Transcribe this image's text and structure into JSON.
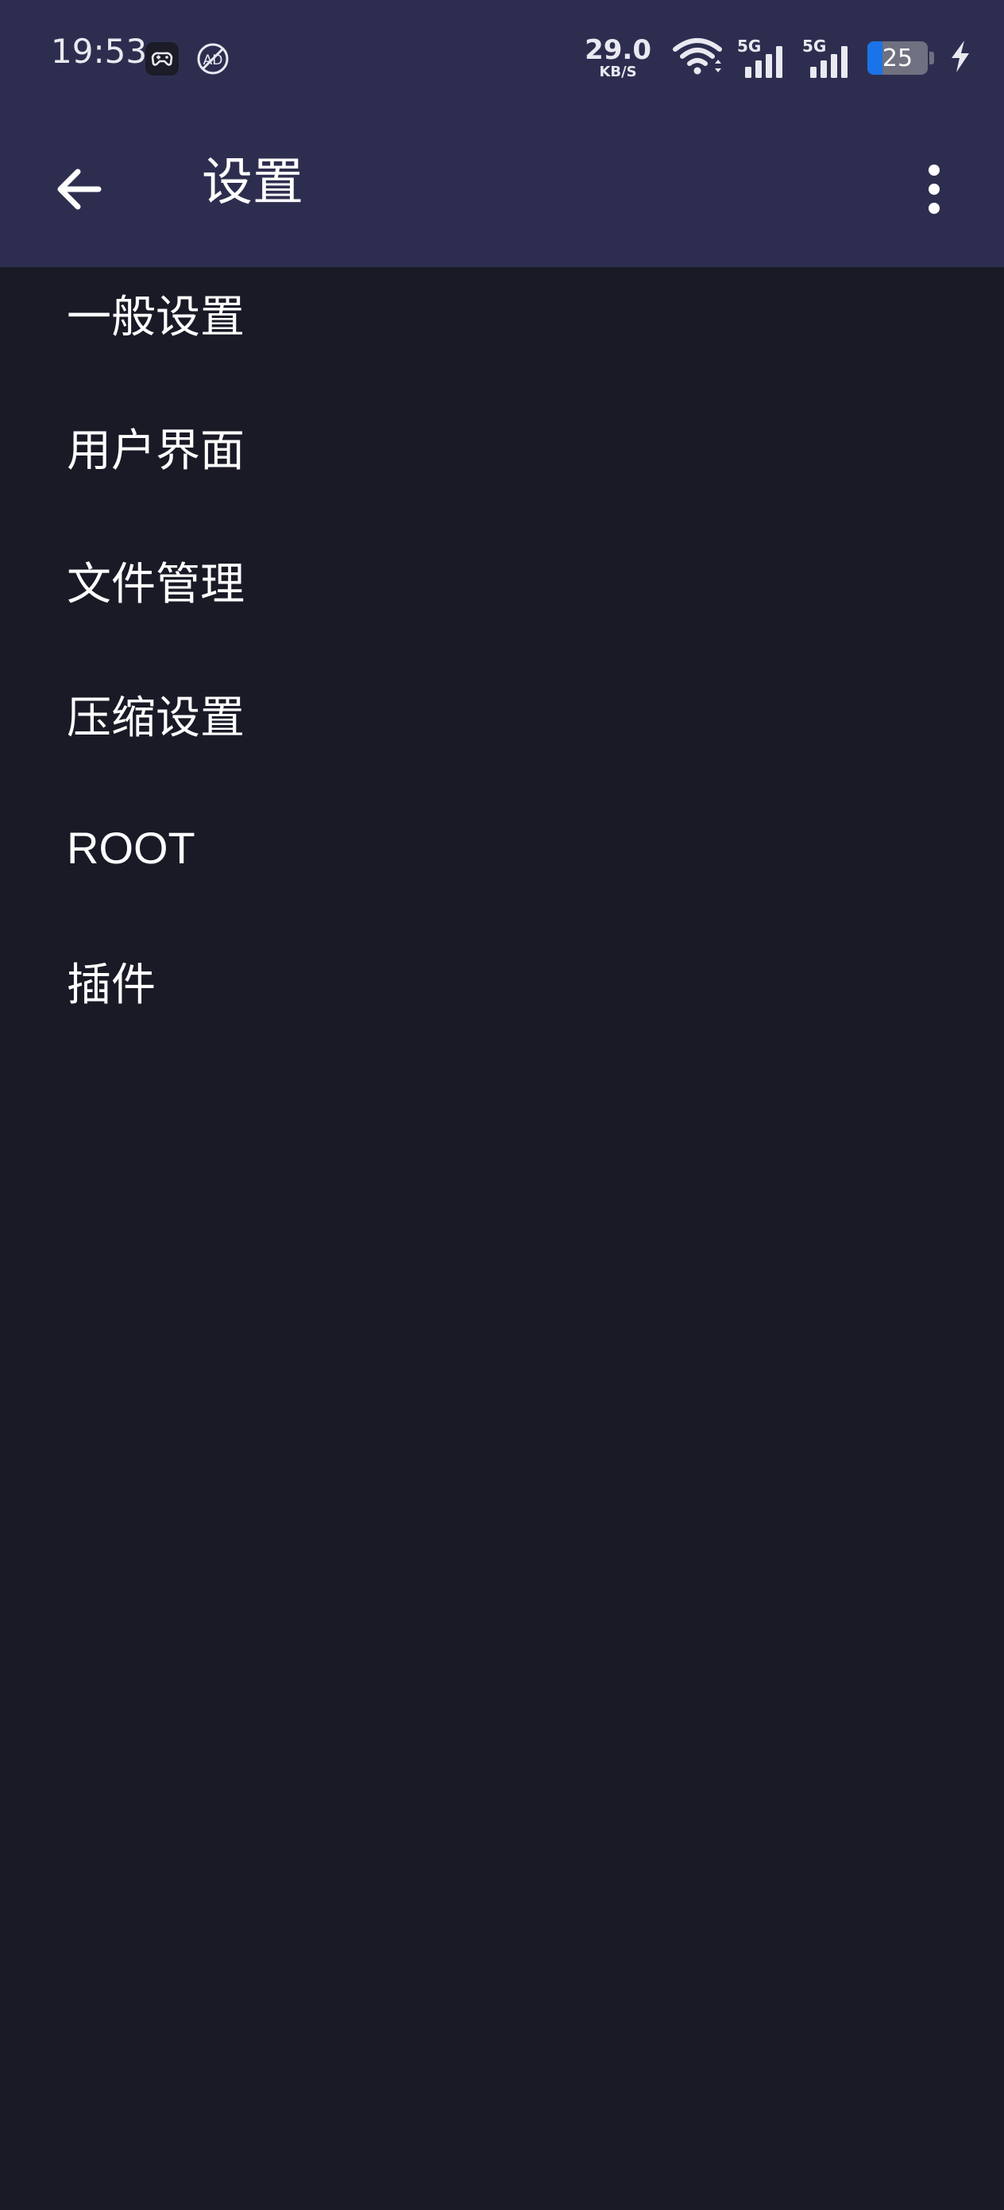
{
  "status_bar": {
    "time": "19:53",
    "net_speed_value": "29.0",
    "net_speed_unit": "KB/S",
    "signal_1_label": "5G",
    "signal_2_label": "5G",
    "battery_level": "25",
    "battery_fraction": 0.25,
    "left_icons": [
      "game-assistant-icon",
      "ad-block-icon"
    ],
    "right_icons": [
      "wifi-icon",
      "signal-icon",
      "battery-icon",
      "charging-icon"
    ]
  },
  "app_bar": {
    "title": "设置",
    "back_icon": "arrow-left-icon",
    "more_icon": "more-vertical-icon"
  },
  "menu": {
    "items": [
      {
        "label": "一般设置"
      },
      {
        "label": "用户界面"
      },
      {
        "label": "文件管理"
      },
      {
        "label": "压缩设置"
      },
      {
        "label": "ROOT"
      },
      {
        "label": "插件"
      }
    ]
  },
  "colors": {
    "header_bg": "#2d2e4f",
    "body_bg": "#191a26",
    "text": "#ffffff",
    "battery_fill": "#1a73e8"
  }
}
